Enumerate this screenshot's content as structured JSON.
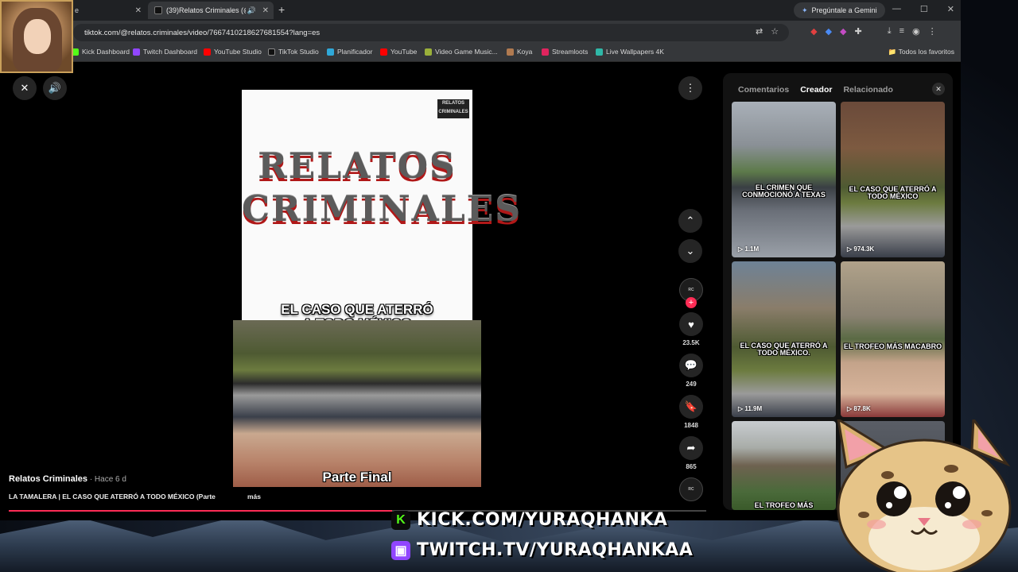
{
  "browser": {
    "tabs": [
      {
        "title": "e",
        "active": false
      },
      {
        "title": "(39)Relatos Criminales (@re",
        "active": true
      }
    ],
    "gemini_label": "Pregúntale a Gemini",
    "url": "tiktok.com/@relatos.criminales/video/7667410218627681554?lang=es",
    "bookmarks": [
      {
        "label": "Kick Dashboard",
        "color": "#53fc18"
      },
      {
        "label": "Twitch Dashboard",
        "color": "#9146ff"
      },
      {
        "label": "YouTube Studio",
        "color": "#ff0000"
      },
      {
        "label": "TikTok Studio",
        "color": "#111111"
      },
      {
        "label": "Planificador",
        "color": "#2fa8d8"
      },
      {
        "label": "YouTube",
        "color": "#ff0000"
      },
      {
        "label": "Video Game Music...",
        "color": "#9ab03a"
      },
      {
        "label": "Koya",
        "color": "#b07a50"
      },
      {
        "label": "Streamloots",
        "color": "#e0245e"
      },
      {
        "label": "Live Wallpapers 4K",
        "color": "#2fb8a8"
      }
    ],
    "bookmarks_folder": "Todos los favoritos"
  },
  "video": {
    "logo_line1": "RELATOS",
    "logo_line2": "CRIMINALES",
    "watermark_line1": "RELATOS",
    "watermark_line2": "CRIMINALES",
    "caption_top_line1": "EL CASO QUE ATERRÓ",
    "caption_top_line2": "A TODO MÉXICO",
    "caption_bottom": "Parte Final",
    "author": "Relatos Criminales",
    "time": " · Hace 6 d",
    "description": "LA TAMALERA | EL CASO QUE ATERRÓ A TODO MÉXICO (Parte",
    "more_label": "más",
    "progress_percent": 55
  },
  "actions": {
    "likes": "23.5K",
    "comments": "249",
    "saves": "1848",
    "shares": "865"
  },
  "panel": {
    "tabs": [
      "Comentarios",
      "Creador",
      "Relacionado"
    ],
    "active_tab": "Creador",
    "thumbs": [
      {
        "label": "EL CRIMEN QUE CONMOCIONÓ A TEXAS",
        "views": "1.1M"
      },
      {
        "label": "EL CASO QUE ATERRÓ A TODO MÉXICO",
        "views": "974.3K"
      },
      {
        "label": "EL CASO QUE ATERRÓ A TODO MÉXICO.",
        "views": "11.9M"
      },
      {
        "label": "EL TROFEO MÁS MACABRO",
        "views": "87.8K"
      },
      {
        "label": "EL TROFEO MÁS",
        "views": ""
      }
    ]
  },
  "overlay": {
    "kick_url": "KICK.COM/YURAQHANKA",
    "twitch_url": "TWITCH.TV/YURAQHANKAA"
  }
}
